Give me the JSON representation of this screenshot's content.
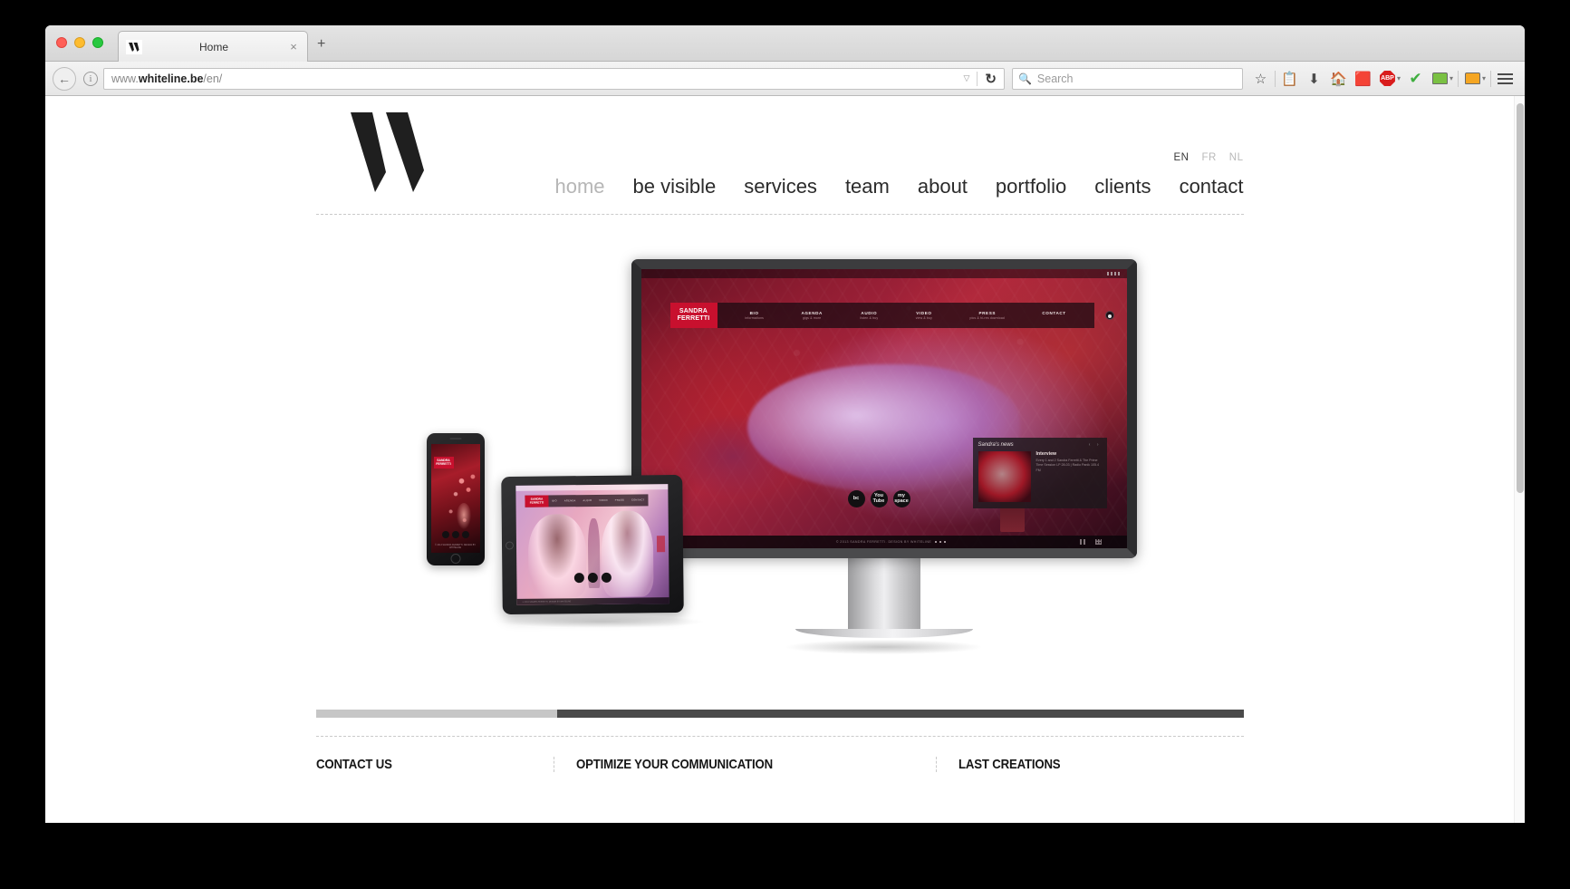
{
  "browser": {
    "tab": {
      "title": "Home",
      "favicon": "whiteline-logo-icon",
      "close": "×"
    },
    "new_tab": "+",
    "back_glyph": "←",
    "info_glyph": "i",
    "url": {
      "prefix": "www.",
      "bold": "whiteline.be",
      "suffix": "/en/",
      "full": "www.whiteline.be/en/"
    },
    "url_dropdown_glyph": "▽",
    "reload_glyph": "↻",
    "search": {
      "placeholder": "Search",
      "icon": "search-icon"
    },
    "toolbar_icons": [
      "bookmark-star-icon",
      "reader-list-icon",
      "downloads-icon",
      "home-icon",
      "pocket-icon",
      "adblock-plus-icon",
      "checkmark-icon",
      "green-book-icon",
      "orange-book-icon",
      "menu-hamburger-icon"
    ],
    "adblock_label": "ABP",
    "caret_glyph": "▾"
  },
  "site": {
    "logo_alt": "whiteline-logo",
    "languages": [
      {
        "code": "EN",
        "active": true
      },
      {
        "code": "FR",
        "active": false
      },
      {
        "code": "NL",
        "active": false
      }
    ],
    "nav": [
      {
        "label": "home",
        "active": true
      },
      {
        "label": "be visible",
        "active": false
      },
      {
        "label": "services",
        "active": false
      },
      {
        "label": "team",
        "active": false
      },
      {
        "label": "about",
        "active": false
      },
      {
        "label": "portfolio",
        "active": false
      },
      {
        "label": "clients",
        "active": false
      },
      {
        "label": "contact",
        "active": false
      }
    ],
    "slider": {
      "progress_percent": 26
    },
    "footer": {
      "columns": [
        {
          "heading": "CONTACT US"
        },
        {
          "heading": "OPTIMIZE YOUR COMMUNICATION"
        },
        {
          "heading": "LAST CREATIONS"
        }
      ]
    }
  },
  "showcase": {
    "brand": {
      "line1": "SANDRA",
      "line2": "FERRETTI"
    },
    "desktop_nav": [
      {
        "main": "BIO",
        "sub": "informations"
      },
      {
        "main": "AGENDA",
        "sub": "gigs & more"
      },
      {
        "main": "AUDIO",
        "sub": "listen & buy"
      },
      {
        "main": "VIDEO",
        "sub": "view & buy"
      },
      {
        "main": "PRESS",
        "sub": "pics & hi-res download"
      },
      {
        "main": "CONTACT",
        "sub": ""
      }
    ],
    "socials": [
      "soundcloud-icon",
      "youtube-icon",
      "myspace-icon"
    ],
    "social_labels": [
      "bc",
      "You Tube",
      "my space"
    ],
    "news": {
      "panel_title": "Sandra's news",
      "arrows": "‹ ›",
      "headline": "Interview",
      "body": "Every 1 and 2 Sandra Ferretti & The Prime Time Session LP 28-03 | Radio Panik 105.4 FM"
    },
    "footer_text": "© 2013 SANDRA FERRETTI. DESIGN BY WHITELINE",
    "mobile_footer": "© 2013 SANDRA FERRETTI. DESIGN BY WHITELINE"
  }
}
